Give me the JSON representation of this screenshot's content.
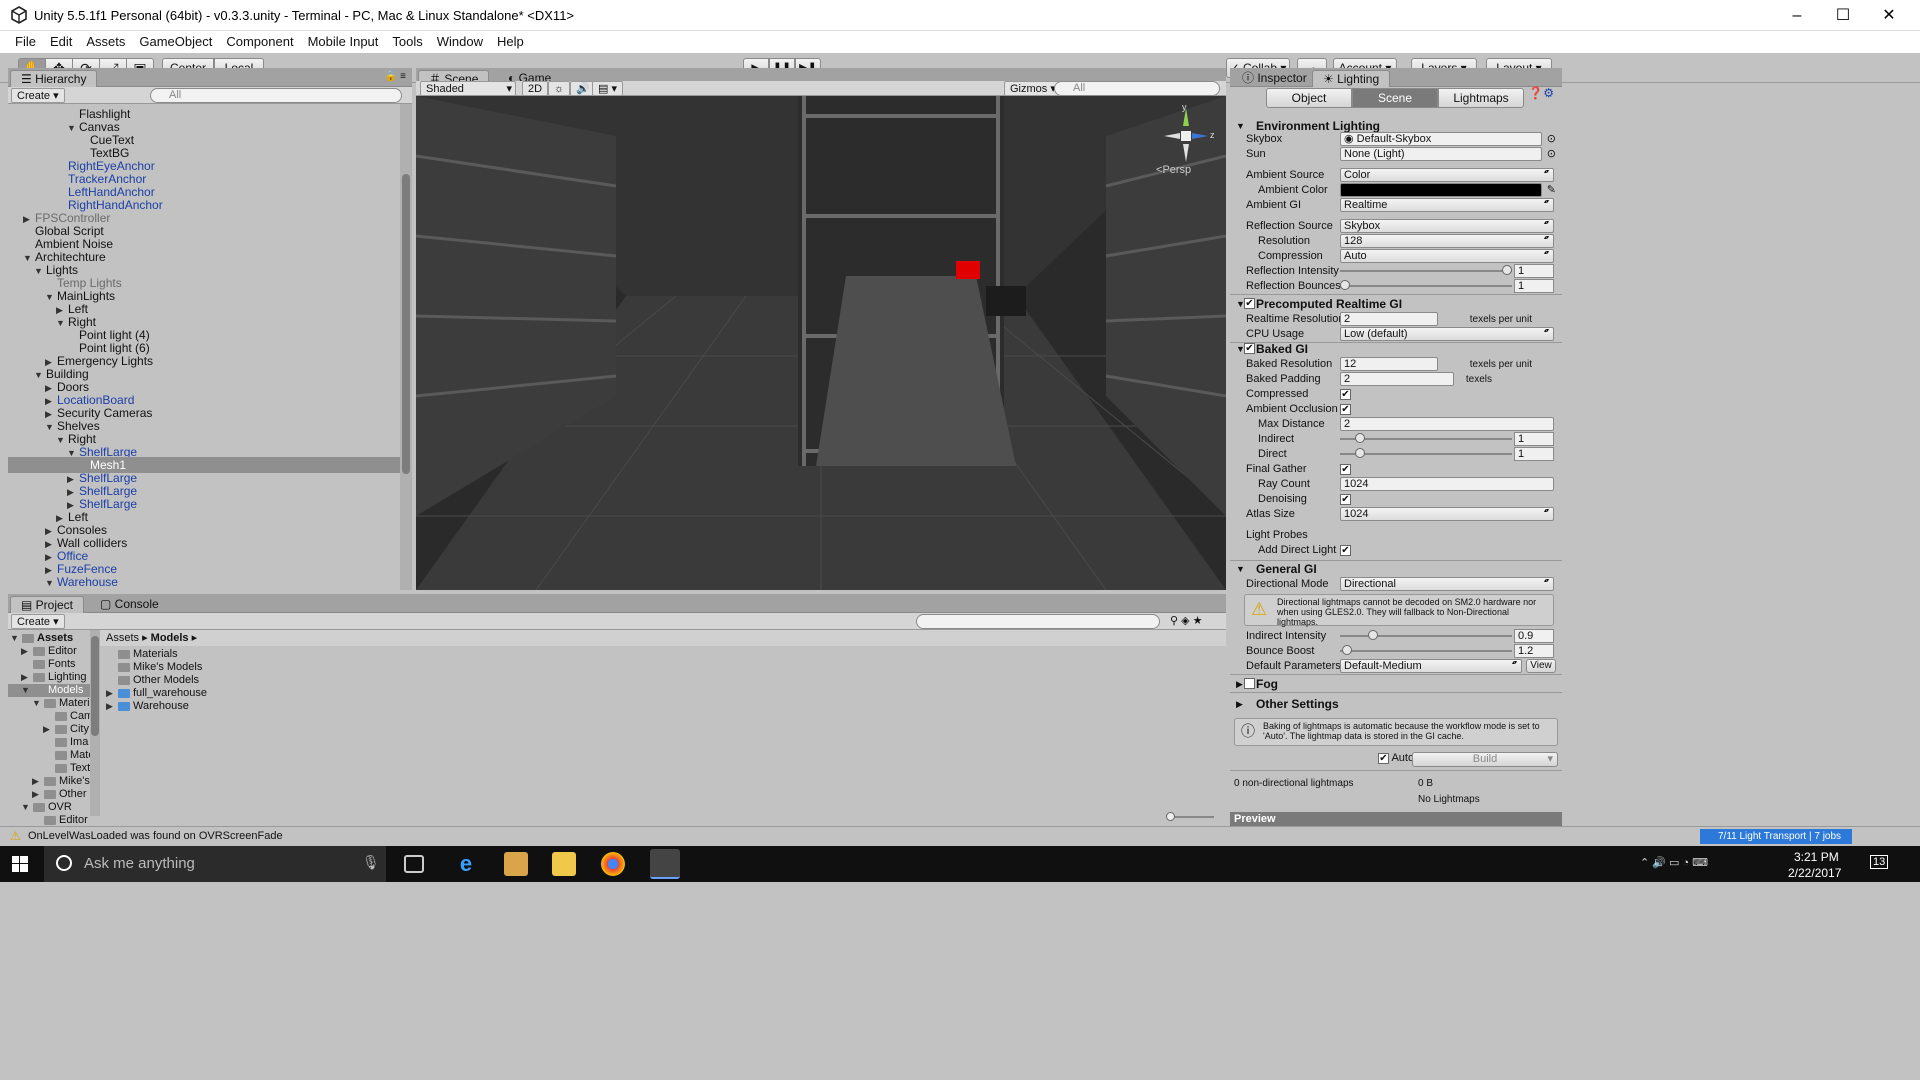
{
  "window": {
    "title": "Unity 5.5.1f1 Personal (64bit) - v0.3.3.unity - Terminal - PC, Mac & Linux Standalone* <DX11>",
    "minimize": "–",
    "maximize": "☐",
    "close": "✕"
  },
  "menu": [
    "File",
    "Edit",
    "Assets",
    "GameObject",
    "Component",
    "Mobile Input",
    "Tools",
    "Window",
    "Help"
  ],
  "toolbar": {
    "center": "Center",
    "local": "Local",
    "collab": "Collab",
    "account": "Account",
    "layers": "Layers",
    "layout": "Layout"
  },
  "hierarchy": {
    "tab": "Hierarchy",
    "create": "Create",
    "search": "All",
    "rows": [
      {
        "label": "Flashlight",
        "indent": 5,
        "fold": "",
        "style": ""
      },
      {
        "label": "Canvas",
        "indent": 5,
        "fold": "▼",
        "style": ""
      },
      {
        "label": "CueText",
        "indent": 6,
        "fold": "",
        "style": ""
      },
      {
        "label": "TextBG",
        "indent": 6,
        "fold": "",
        "style": ""
      },
      {
        "label": "RightEyeAnchor",
        "indent": 4,
        "fold": "",
        "style": "blue"
      },
      {
        "label": "TrackerAnchor",
        "indent": 4,
        "fold": "",
        "style": "blue"
      },
      {
        "label": "LeftHandAnchor",
        "indent": 4,
        "fold": "",
        "style": "blue"
      },
      {
        "label": "RightHandAnchor",
        "indent": 4,
        "fold": "",
        "style": "blue"
      },
      {
        "label": "FPSController",
        "indent": 1,
        "fold": "▶",
        "style": "gray"
      },
      {
        "label": "Global Script",
        "indent": 1,
        "fold": "",
        "style": ""
      },
      {
        "label": "Ambient Noise",
        "indent": 1,
        "fold": "",
        "style": ""
      },
      {
        "label": "Architechture",
        "indent": 1,
        "fold": "▼",
        "style": ""
      },
      {
        "label": "Lights",
        "indent": 2,
        "fold": "▼",
        "style": ""
      },
      {
        "label": "Temp Lights",
        "indent": 3,
        "fold": "",
        "style": "gray"
      },
      {
        "label": "MainLights",
        "indent": 3,
        "fold": "▼",
        "style": ""
      },
      {
        "label": "Left",
        "indent": 4,
        "fold": "▶",
        "style": ""
      },
      {
        "label": "Right",
        "indent": 4,
        "fold": "▼",
        "style": ""
      },
      {
        "label": "Point light (4)",
        "indent": 5,
        "fold": "",
        "style": ""
      },
      {
        "label": "Point light (6)",
        "indent": 5,
        "fold": "",
        "style": ""
      },
      {
        "label": "Emergency Lights",
        "indent": 3,
        "fold": "▶",
        "style": ""
      },
      {
        "label": "Building",
        "indent": 2,
        "fold": "▼",
        "style": ""
      },
      {
        "label": "Doors",
        "indent": 3,
        "fold": "▶",
        "style": ""
      },
      {
        "label": "LocationBoard",
        "indent": 3,
        "fold": "▶",
        "style": "blue"
      },
      {
        "label": "Security Cameras",
        "indent": 3,
        "fold": "▶",
        "style": ""
      },
      {
        "label": "Shelves",
        "indent": 3,
        "fold": "▼",
        "style": ""
      },
      {
        "label": "Right",
        "indent": 4,
        "fold": "▼",
        "style": ""
      },
      {
        "label": "ShelfLarge",
        "indent": 5,
        "fold": "▼",
        "style": "blue"
      },
      {
        "label": "Mesh1",
        "indent": 6,
        "fold": "",
        "style": "sel"
      },
      {
        "label": "ShelfLarge",
        "indent": 5,
        "fold": "▶",
        "style": "blue"
      },
      {
        "label": "ShelfLarge",
        "indent": 5,
        "fold": "▶",
        "style": "blue"
      },
      {
        "label": "ShelfLarge",
        "indent": 5,
        "fold": "▶",
        "style": "blue"
      },
      {
        "label": "Left",
        "indent": 4,
        "fold": "▶",
        "style": ""
      },
      {
        "label": "Consoles",
        "indent": 3,
        "fold": "▶",
        "style": ""
      },
      {
        "label": "Wall colliders",
        "indent": 3,
        "fold": "▶",
        "style": ""
      },
      {
        "label": "Office",
        "indent": 3,
        "fold": "▶",
        "style": "blue"
      },
      {
        "label": "FuzeFence",
        "indent": 3,
        "fold": "▶",
        "style": "blue"
      },
      {
        "label": "Warehouse",
        "indent": 3,
        "fold": "▼",
        "style": "blue"
      }
    ]
  },
  "scene": {
    "tab_scene": "Scene",
    "tab_game": "Game",
    "shaded": "Shaded",
    "mode_2d": "2D",
    "gizmos": "Gizmos",
    "search": "All",
    "persp": "Persp",
    "axis_y": "y",
    "axis_z": "z"
  },
  "inspector": {
    "tab_inspector": "Inspector",
    "tab_lighting": "Lighting",
    "seg": [
      "Object",
      "Scene",
      "Lightmaps"
    ],
    "env_title": "Environment Lighting",
    "skybox_label": "Skybox",
    "skybox_value": "Default-Skybox",
    "sun_label": "Sun",
    "sun_value": "None (Light)",
    "ambient_source_label": "Ambient Source",
    "ambient_source_value": "Color",
    "ambient_color_label": "Ambient Color",
    "ambient_color": "#000000",
    "ambient_gi_label": "Ambient GI",
    "ambient_gi_value": "Realtime",
    "reflection_source_label": "Reflection Source",
    "reflection_source_value": "Skybox",
    "resolution_label": "Resolution",
    "resolution_value": "128",
    "compression_label": "Compression",
    "compression_value": "Auto",
    "reflection_intensity_label": "Reflection Intensity",
    "reflection_intensity_value": "1",
    "reflection_intensity_level": 1.0,
    "reflection_bounces_label": "Reflection Bounces",
    "reflection_bounces_value": "1",
    "reflection_bounces_level": 0.0,
    "precomputed_title": "Precomputed Realtime GI",
    "realtime_resolution_label": "Realtime Resolution",
    "realtime_resolution_value": "2",
    "texels_per_unit": "texels per unit",
    "cpu_usage_label": "CPU Usage",
    "cpu_usage_value": "Low (default)",
    "baked_title": "Baked GI",
    "baked_resolution_label": "Baked Resolution",
    "baked_resolution_value": "12",
    "baked_padding_label": "Baked Padding",
    "baked_padding_value": "2",
    "texels": "texels",
    "compressed_label": "Compressed",
    "ao_label": "Ambient Occlusion",
    "max_distance_label": "Max Distance",
    "max_distance_value": "2",
    "indirect_label": "Indirect",
    "indirect_value": "1",
    "direct_label": "Direct",
    "direct_value": "1",
    "final_gather_label": "Final Gather",
    "ray_count_label": "Ray Count",
    "ray_count_value": "1024",
    "denoising_label": "Denoising",
    "atlas_size_label": "Atlas Size",
    "atlas_size_value": "1024",
    "light_probes_label": "Light Probes",
    "add_direct_light_label": "Add Direct Light",
    "general_title": "General GI",
    "directional_mode_label": "Directional Mode",
    "directional_mode_value": "Directional",
    "warning": "Directional lightmaps cannot be decoded on SM2.0 hardware nor when using GLES2.0. They will fallback to Non-Directional lightmaps.",
    "indirect_intensity_label": "Indirect Intensity",
    "indirect_intensity_value": "0.9",
    "bounce_boost_label": "Bounce Boost",
    "bounce_boost_value": "1.2",
    "default_params_label": "Default Parameters",
    "default_params_value": "Default-Medium",
    "view": "View",
    "fog_title": "Fog",
    "other_title": "Other Settings",
    "info": "Baking of lightmaps is automatic because the workflow mode is set to 'Auto'. The lightmap data is stored in the GI cache.",
    "auto": "Auto",
    "build": "Build",
    "lightmaps_count": "0 non-directional lightmaps",
    "lightmaps_size": "0 B",
    "no_lightmaps": "No Lightmaps",
    "preview": "Preview"
  },
  "project": {
    "tab_project": "Project",
    "tab_console": "Console",
    "create": "Create",
    "breadcrumb_root": "Assets",
    "breadcrumb_current": "Models",
    "tree": [
      {
        "label": "Assets",
        "indent": 0,
        "fold": "▼",
        "bold": true,
        "sel": false
      },
      {
        "label": "Editor",
        "indent": 1,
        "fold": "▶",
        "bold": false,
        "sel": false
      },
      {
        "label": "Fonts",
        "indent": 1,
        "fold": "",
        "bold": false,
        "sel": false
      },
      {
        "label": "Lighting E",
        "indent": 1,
        "fold": "▶",
        "bold": false,
        "sel": false
      },
      {
        "label": "Models",
        "indent": 1,
        "fold": "▼",
        "bold": false,
        "sel": true
      },
      {
        "label": "Materia",
        "indent": 2,
        "fold": "▼",
        "bold": false,
        "sel": false
      },
      {
        "label": "Cam",
        "indent": 3,
        "fold": "",
        "bold": false,
        "sel": false
      },
      {
        "label": "City",
        "indent": 3,
        "fold": "▶",
        "bold": false,
        "sel": false
      },
      {
        "label": "Ima",
        "indent": 3,
        "fold": "",
        "bold": false,
        "sel": false
      },
      {
        "label": "Mate",
        "indent": 3,
        "fold": "",
        "bold": false,
        "sel": false
      },
      {
        "label": "Text",
        "indent": 3,
        "fold": "",
        "bold": false,
        "sel": false
      },
      {
        "label": "Mike's",
        "indent": 2,
        "fold": "▶",
        "bold": false,
        "sel": false
      },
      {
        "label": "Other I",
        "indent": 2,
        "fold": "▶",
        "bold": false,
        "sel": false
      },
      {
        "label": "OVR",
        "indent": 1,
        "fold": "▼",
        "bold": false,
        "sel": false
      },
      {
        "label": "Editor",
        "indent": 2,
        "fold": "",
        "bold": false,
        "sel": false
      }
    ],
    "files": [
      {
        "label": "Materials",
        "type": "folder"
      },
      {
        "label": "Mike's Models",
        "type": "folder"
      },
      {
        "label": "Other Models",
        "type": "folder"
      },
      {
        "label": "full_warehouse",
        "type": "model"
      },
      {
        "label": "Warehouse",
        "type": "model"
      }
    ]
  },
  "status": {
    "message": "OnLevelWasLoaded was found on OVRScreenFade",
    "progress": "7/11 Light Transport",
    "jobs": "7 jobs"
  },
  "taskbar": {
    "search": "Ask me anything",
    "time": "3:21 PM",
    "date": "2/22/2017",
    "notifications": "13"
  }
}
